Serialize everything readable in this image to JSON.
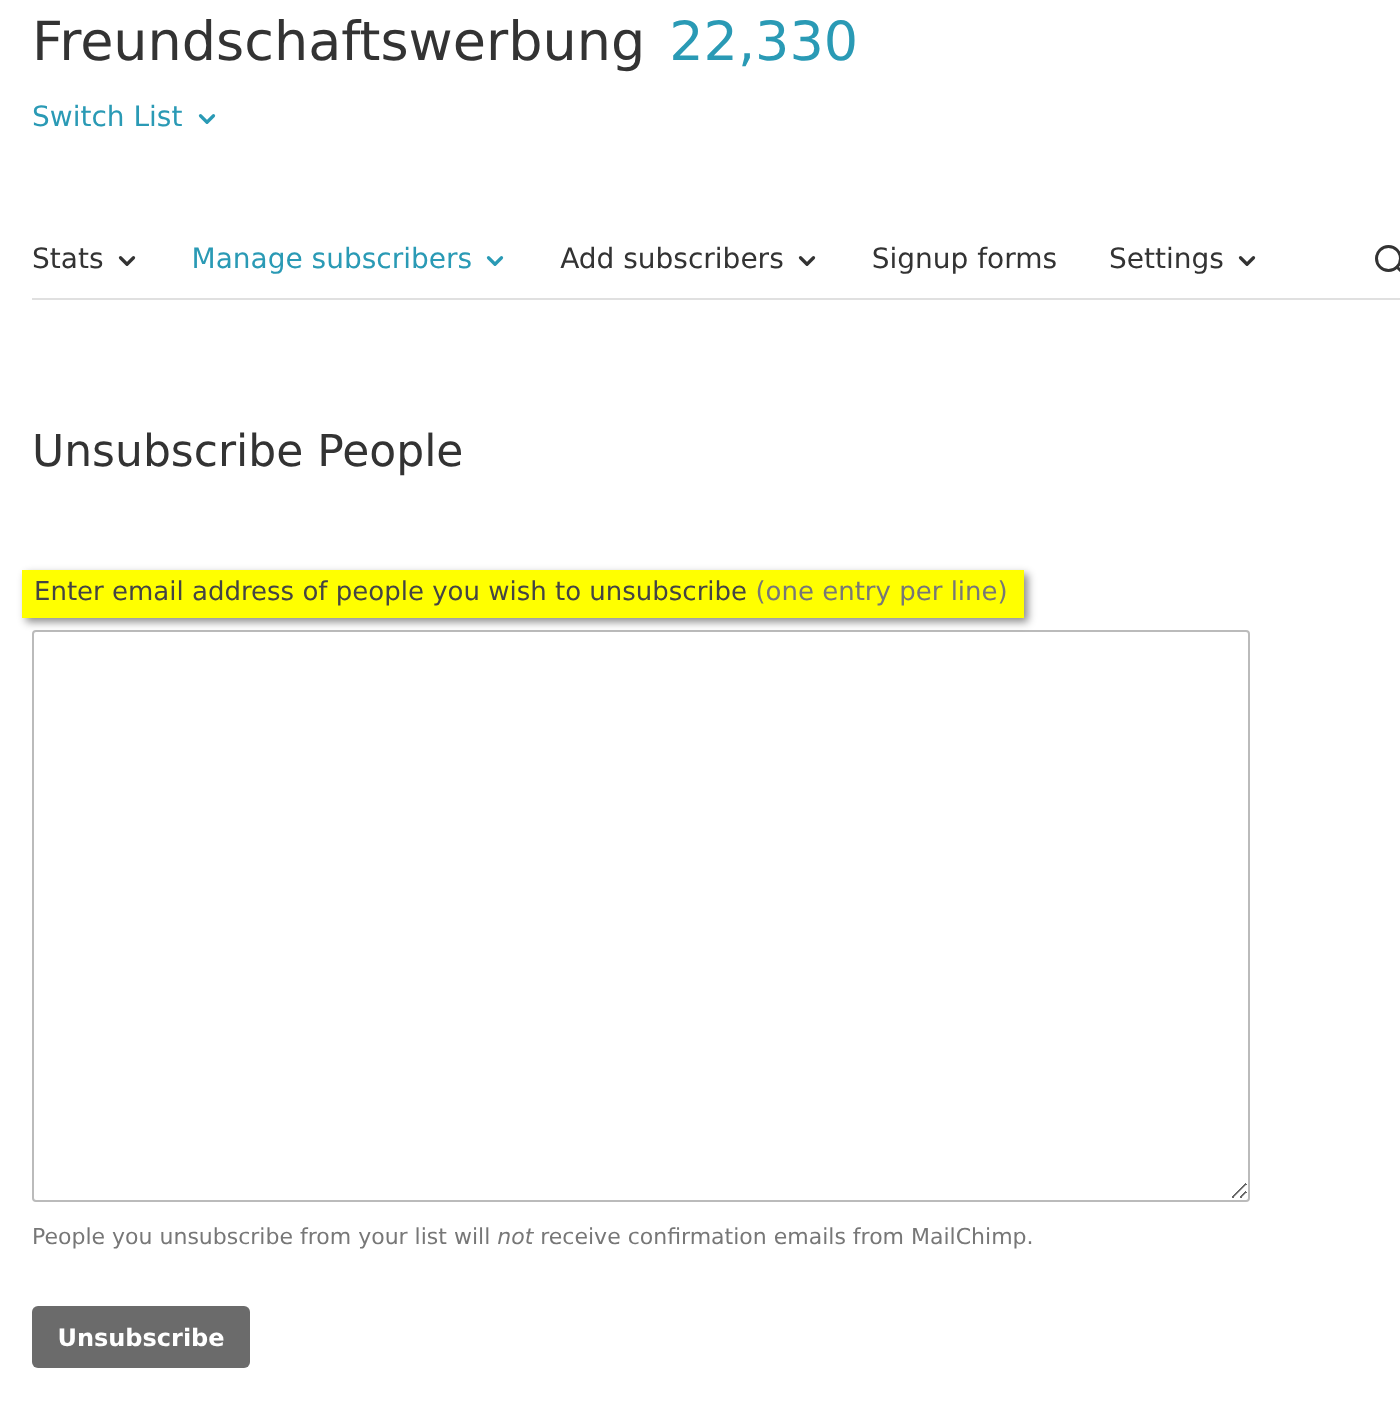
{
  "list": {
    "name": "Freundschaftswerbung",
    "count": "22,330",
    "switch_label": "Switch List"
  },
  "nav": [
    {
      "label": "Stats",
      "kind": "dropdown",
      "selected": false
    },
    {
      "label": "Manage subscribers",
      "kind": "dropdown",
      "selected": true
    },
    {
      "label": "Add subscribers",
      "kind": "dropdown",
      "selected": false
    },
    {
      "label": "Signup forms",
      "kind": "link",
      "selected": false
    },
    {
      "label": "Settings",
      "kind": "dropdown",
      "selected": false
    }
  ],
  "heading": "Unsubscribe People",
  "field": {
    "label": "Enter email address of people you wish to unsubscribe",
    "hint": "(one entry per line)",
    "highlighted": true
  },
  "note": "People you unsubscribe from your list will *not* receive confirmation emails from MailChimp.",
  "button": "Unsubscribe"
}
